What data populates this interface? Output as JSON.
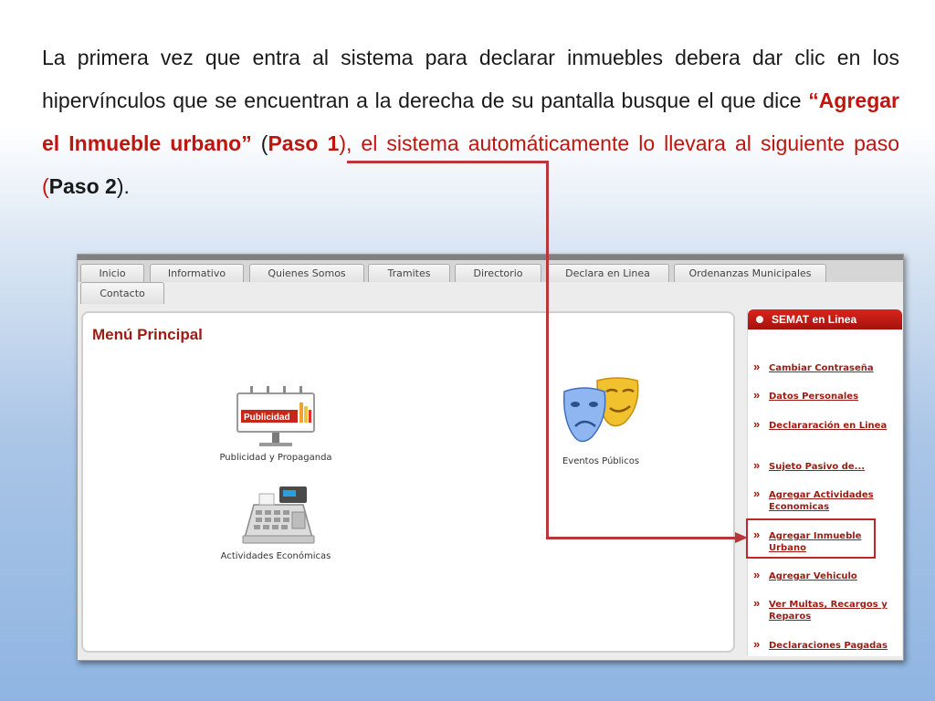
{
  "instruction": {
    "t1": "La primera vez que entra al sistema para declarar inmuebles debera dar clic en los hipervínculos que se encuentran a la derecha de su pantalla busque el que dice ",
    "t2": "“Agregar el Inmueble urbano”",
    "t3": " (",
    "t4": "Paso 1",
    "t5": "), el sistema automáticamente lo llevara al siguiente paso (",
    "t6": "Paso 2",
    "t7": ")."
  },
  "nav": {
    "tabs": [
      "Inicio",
      "Informativo",
      "Quienes Somos",
      "Tramites",
      "Directorio",
      "Declara en Linea",
      "Ordenanzas Municipales"
    ],
    "row2": [
      "Contacto"
    ]
  },
  "main": {
    "title": "Menú Principal",
    "billboard_text": "Publicidad",
    "items": [
      {
        "label": "Publicidad y Propaganda",
        "icon": "billboard-icon"
      },
      {
        "label": "Eventos Públicos",
        "icon": "theater-masks-icon"
      },
      {
        "label": "Actividades Económicas",
        "icon": "cash-register-icon"
      }
    ]
  },
  "sidebar": {
    "title": "SEMAT en Linea",
    "links": [
      "Cambiar Contraseña",
      "Datos Personales",
      "Declararación en Linea",
      "Sujeto Pasivo de...",
      "Agregar Actividades Economicas",
      "Agregar Inmueble Urbano",
      "Agregar Vehiculo",
      "Ver Multas, Recargos y Reparos",
      "Declaraciones Pagadas"
    ]
  },
  "colors": {
    "accent_red": "#c0150f",
    "link_red": "#9b1c12",
    "highlight": "#c0262c"
  }
}
